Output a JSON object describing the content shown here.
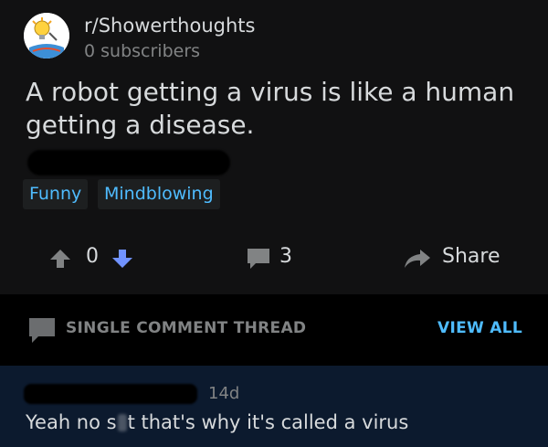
{
  "subreddit": {
    "name": "r/Showerthoughts",
    "subscribers": "0 subscribers",
    "icon": "lightbulb-icon"
  },
  "post": {
    "title": "A robot getting a virus is like a human getting a disease.",
    "flairs": [
      "Funny",
      "Mindblowing"
    ]
  },
  "actions": {
    "vote_count": "0",
    "comment_count": "3",
    "share_label": "Share"
  },
  "thread": {
    "label": "SINGLE COMMENT THREAD",
    "view_all_label": "VIEW ALL"
  },
  "comment": {
    "time": "14d",
    "text_before": "Yeah no s",
    "text_after": "t that's why it's called a virus"
  },
  "colors": {
    "background": "#000000",
    "card": "#111112",
    "comment_highlight": "#0c1a2e",
    "text_primary": "#d7dadc",
    "text_muted": "#818384",
    "accent_blue": "#4fbcff",
    "upvote_gray": "#818384",
    "downvote_blue": "#7193ff"
  }
}
